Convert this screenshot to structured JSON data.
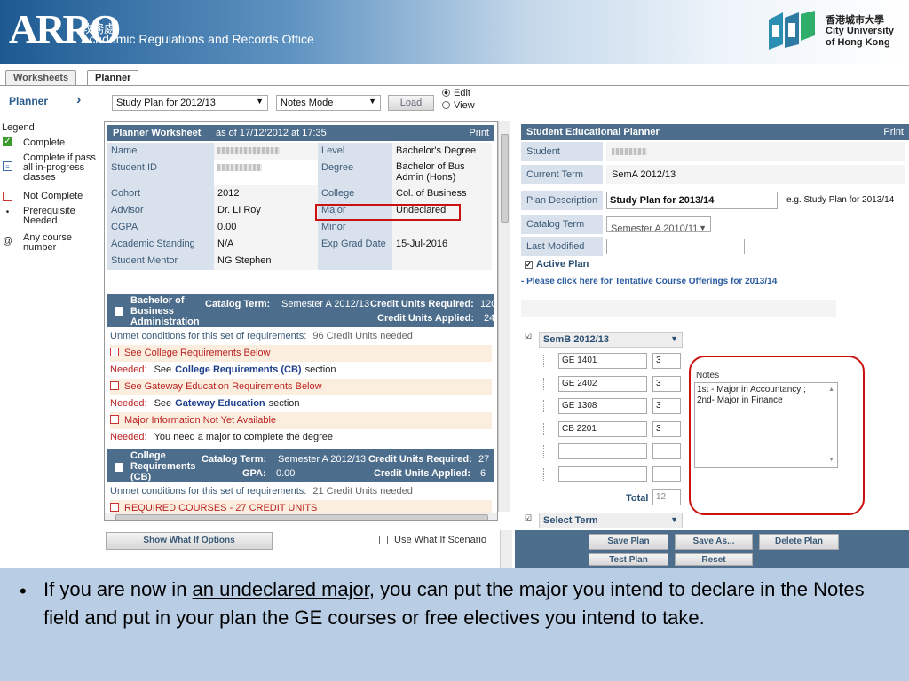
{
  "header": {
    "logo_text": "ARRO",
    "office_zh": "教務處",
    "office_en": "Academic Regulations and Records Office",
    "university_zh": "香港城市大學",
    "university_en1": "City University",
    "university_en2": "of Hong Kong"
  },
  "tabs": [
    {
      "label": "Worksheets",
      "active": false
    },
    {
      "label": "Planner",
      "active": true
    }
  ],
  "toolbar": {
    "planner_label": "Planner",
    "plan_select": "Study Plan for 2012/13",
    "mode_select": "Notes Mode",
    "load_button": "Load",
    "radio_edit": "Edit",
    "radio_view": "View",
    "selected_radio": "Edit"
  },
  "legend": {
    "title": "Legend",
    "items": [
      {
        "label": "Complete",
        "icon": "check-icon",
        "color": "#3a9a2c"
      },
      {
        "label": "Complete if pass all in-progress classes",
        "icon": "in-progress-icon",
        "color": "#3a6ab0"
      },
      {
        "label": "Not Complete",
        "icon": "empty-box-icon",
        "color": "#cc3333"
      },
      {
        "label": "Prerequisite Needed",
        "icon": "asterisk-icon",
        "color": "#333333"
      },
      {
        "label": "Any course number",
        "icon": "at-icon",
        "color": "#333333"
      }
    ]
  },
  "worksheet": {
    "title": "Planner Worksheet",
    "as_of": "as of 17/12/2012 at 17:35",
    "print": "Print",
    "rows": [
      {
        "l1": "Name",
        "v1": "",
        "l2": "Level",
        "v2": "Bachelor's Degree"
      },
      {
        "l1": "Student ID",
        "v1": "",
        "l2": "Degree",
        "v2": "Bachelor of Bus Admin (Hons)"
      },
      {
        "l1": "Cohort",
        "v1": "2012",
        "l2": "College",
        "v2": "Col. of Business"
      },
      {
        "l1": "Advisor",
        "v1": "Dr. LI Roy",
        "l2": "Major",
        "v2": "Undeclared"
      },
      {
        "l1": "CGPA",
        "v1": "0.00",
        "l2": "Minor",
        "v2": ""
      },
      {
        "l1": "Academic Standing",
        "v1": "N/A",
        "l2": "Exp Grad Date",
        "v2": "15-Jul-2016"
      },
      {
        "l1": "Student Mentor",
        "v1": "NG Stephen",
        "l2": "",
        "v2": ""
      }
    ],
    "block1": {
      "name": "Bachelor of Business Administration",
      "catalog_label": "Catalog Term:",
      "catalog_value": "Semester A 2012/13",
      "units_required_label": "Credit Units Required:",
      "units_required": "120",
      "units_applied_label": "Credit Units Applied:",
      "units_applied": "24"
    },
    "unmet1_label": "Unmet conditions for this set of requirements:",
    "unmet1_value": "96 Credit Units needed",
    "req_lines": [
      {
        "type": "box",
        "text": "See College Requirements Below"
      },
      {
        "type": "needed",
        "prefix": "Needed:",
        "pre": "See",
        "bold": "College Requirements (CB)",
        "post": "section"
      },
      {
        "type": "box",
        "text": "See Gateway Education Requirements Below"
      },
      {
        "type": "needed",
        "prefix": "Needed:",
        "pre": "See",
        "bold": "Gateway Education",
        "post": "section"
      },
      {
        "type": "box",
        "text": "Major Information Not Yet Available"
      },
      {
        "type": "needed",
        "prefix": "Needed:",
        "pre": "You need a major to complete the degree",
        "bold": "",
        "post": ""
      }
    ],
    "block2": {
      "name": "College Requirements (CB)",
      "catalog_label": "Catalog Term:",
      "catalog_value": "Semester A 2012/13",
      "units_required_label": "Credit Units Required:",
      "units_required": "27",
      "gpa_label": "GPA:",
      "gpa_value": "0.00",
      "units_applied_label": "Credit Units Applied:",
      "units_applied": "6"
    },
    "unmet2_label": "Unmet conditions for this set of requirements:",
    "unmet2_value": "21 Credit Units needed",
    "req_courses": "REQUIRED COURSES - 27 CREDIT UNITS"
  },
  "bottom_left": {
    "what_if_button": "Show What If Options",
    "use_what_if": "Use What If Scenario"
  },
  "sep": {
    "title": "Student Educational Planner",
    "print": "Print",
    "student_label": "Student",
    "current_term_label": "Current Term",
    "current_term": "SemA 2012/13",
    "plan_desc_label": "Plan Description",
    "plan_desc": "Study Plan for 2013/14",
    "plan_desc_example": "e.g. Study Plan for 2013/14",
    "catalog_term_label": "Catalog Term",
    "catalog_term": "Semester A 2010/11",
    "last_modified_label": "Last Modified",
    "active_plan": "Active Plan",
    "tentative_link": "- Please click here for Tentative Course Offerings for 2013/14",
    "term_select": "SemB 2012/13",
    "courses": [
      {
        "code": "GE 1401",
        "units": "3"
      },
      {
        "code": "GE 2402",
        "units": "3"
      },
      {
        "code": "GE 1308",
        "units": "3"
      },
      {
        "code": "CB 2201",
        "units": "3"
      },
      {
        "code": "",
        "units": ""
      },
      {
        "code": "",
        "units": ""
      }
    ],
    "total_label": "Total",
    "total_value": "12",
    "notes_label": "Notes",
    "notes_line1": "1st - Major in Accountancy ;",
    "notes_line2": "2nd- Major in Finance",
    "select_term": "Select Term",
    "buttons": {
      "save_plan": "Save Plan",
      "save_as": "Save As...",
      "delete_plan": "Delete Plan",
      "test_plan": "Test Plan",
      "reset": "Reset"
    }
  },
  "caption": {
    "bullet": "•",
    "part1": "If you are now in ",
    "underlined": "an undeclared major",
    "part2": ", you can put the major you intend to declare in the Notes field and put in your plan the GE courses or free electives you intend to take."
  },
  "colors": {
    "header_blue": "#1d5a92",
    "panel_bar": "#4d6d8c",
    "highlight_red": "#cc1111",
    "caption_bg": "#b9cde5"
  }
}
